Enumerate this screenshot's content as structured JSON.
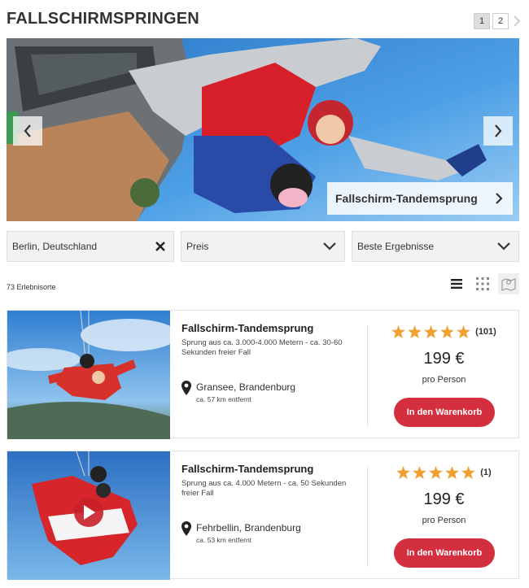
{
  "page": {
    "title": "FALLSCHIRMSPRINGEN",
    "pages": [
      "1",
      "2"
    ]
  },
  "hero": {
    "caption": "Fallschirm-Tandemsprung"
  },
  "filters": {
    "location": "Berlin, Deutschland",
    "price": "Preis",
    "sort": "Beste Ergebnisse"
  },
  "results": {
    "count": "73 Erlebnisorte"
  },
  "cards": [
    {
      "title": "Fallschirm-Tandemsprung",
      "description": "Sprung aus ca. 3.000-4.000 Metern - ca. 30-60 Sekunden freier Fall",
      "location": "Gransee, Brandenburg",
      "distance": "ca. 57 km entfernt",
      "stars": 5,
      "reviews": "(101)",
      "price": "199 €",
      "per": "pro Person",
      "button": "In den Warenkorb"
    },
    {
      "title": "Fallschirm-Tandemsprung",
      "description": "Sprung aus ca. 4.000 Metern - ca. 50 Sekunden freier Fall",
      "location": "Fehrbellin, Brandenburg",
      "distance": "ca. 53 km entfernt",
      "stars": 5,
      "reviews": "(1)",
      "price": "199 €",
      "per": "pro Person",
      "button": "In den Warenkorb"
    }
  ],
  "colors": {
    "accent": "#d32f3f",
    "star": "#f0a030",
    "sky": "#3d8fd8"
  }
}
